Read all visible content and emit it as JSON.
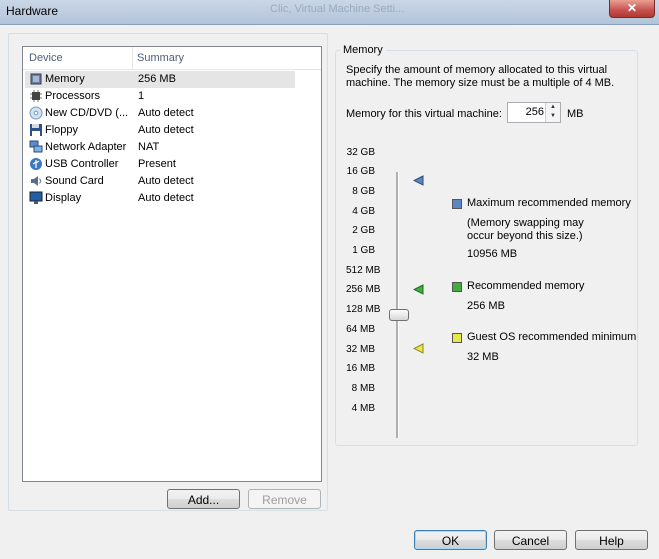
{
  "window": {
    "title": "Hardware",
    "ghost_title": "Clic, Virtual Machine Setti..."
  },
  "devices": {
    "headers": {
      "device": "Device",
      "summary": "Summary"
    },
    "rows": [
      {
        "icon": "memory-icon",
        "device": "Memory",
        "summary": "256 MB",
        "selected": true
      },
      {
        "icon": "processor-icon",
        "device": "Processors",
        "summary": "1"
      },
      {
        "icon": "cd-dvd-icon",
        "device": "New CD/DVD (...",
        "summary": "Auto detect"
      },
      {
        "icon": "floppy-icon",
        "device": "Floppy",
        "summary": "Auto detect"
      },
      {
        "icon": "network-adapter-icon",
        "device": "Network Adapter",
        "summary": "NAT"
      },
      {
        "icon": "usb-icon",
        "device": "USB Controller",
        "summary": "Present"
      },
      {
        "icon": "sound-card-icon",
        "device": "Sound Card",
        "summary": "Auto detect"
      },
      {
        "icon": "display-icon",
        "device": "Display",
        "summary": "Auto detect"
      }
    ],
    "add_label": "Add...",
    "remove_label": "Remove"
  },
  "memory": {
    "group_label": "Memory",
    "description": "Specify the amount of memory allocated to this virtual machine. The memory size must be a multiple of 4 MB.",
    "field_label": "Memory for this virtual machine:",
    "value": "256",
    "unit": "MB",
    "scale": [
      "32 GB",
      "16 GB",
      "8 GB",
      "4 GB",
      "2 GB",
      "1 GB",
      "512 MB",
      "256 MB",
      "128 MB",
      "64 MB",
      "32 MB",
      "16 MB",
      "8 MB",
      "4 MB"
    ],
    "legend": {
      "max_title": "Maximum recommended memory",
      "max_note": "(Memory swapping may occur beyond this size.)",
      "max_value": "10956 MB",
      "rec_title": "Recommended memory",
      "rec_value": "256 MB",
      "min_title": "Guest OS recommended minimum",
      "min_value": "32 MB"
    },
    "colors": {
      "max": "#5b86c4",
      "recommended": "#3fae3f",
      "minimum": "#e8e84a"
    }
  },
  "footer": {
    "ok_label": "OK",
    "cancel_label": "Cancel",
    "help_label": "Help"
  }
}
